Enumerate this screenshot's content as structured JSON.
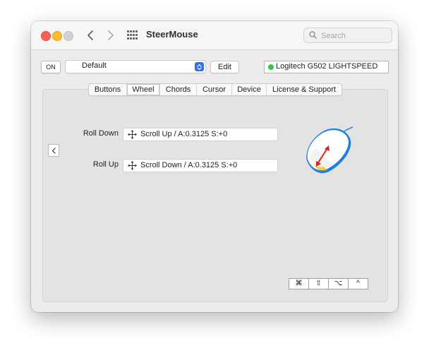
{
  "window": {
    "title": "SteerMouse",
    "search_placeholder": "Search"
  },
  "toolbar": {
    "on_label": "ON",
    "profile_value": "Default",
    "edit_label": "Edit",
    "device_name": "Logitech G502 LIGHTSPEED",
    "device_status_color": "#33c24d"
  },
  "tabs": [
    {
      "label": "Buttons",
      "active": false
    },
    {
      "label": "Wheel",
      "active": true
    },
    {
      "label": "Chords",
      "active": false
    },
    {
      "label": "Cursor",
      "active": false
    },
    {
      "label": "Device",
      "active": false
    },
    {
      "label": "License & Support",
      "active": false
    }
  ],
  "wheel": {
    "rows": [
      {
        "label": "Roll Down",
        "action": "Scroll Up / A:0.3125 S:+0"
      },
      {
        "label": "Roll Up",
        "action": "Scroll Down / A:0.3125 S:+0"
      }
    ]
  },
  "modifiers": [
    {
      "symbol": "⌘",
      "name": "command"
    },
    {
      "symbol": "⇧",
      "name": "shift"
    },
    {
      "symbol": "⌥",
      "name": "option"
    },
    {
      "symbol": "^",
      "name": "control"
    }
  ],
  "icons": {
    "back": "chevron-left-icon",
    "forward": "chevron-right-icon",
    "grid": "app-grid-icon",
    "search": "search-icon",
    "select": "up-down-arrows-icon",
    "collapse": "chevron-left-icon",
    "move": "move-arrows-icon",
    "mouse": "mouse-wheel-illustration"
  }
}
